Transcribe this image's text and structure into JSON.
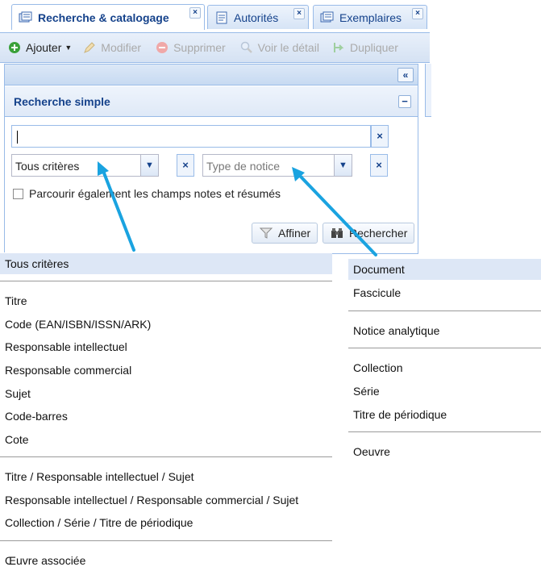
{
  "tabs": [
    {
      "label": "Recherche & catalogage",
      "close": "×"
    },
    {
      "label": "Autorités",
      "close": "×"
    },
    {
      "label": "Exemplaires",
      "close": "×"
    }
  ],
  "toolbar": {
    "add": "Ajouter",
    "edit": "Modifier",
    "delete": "Supprimer",
    "details": "Voir le détail",
    "duplicate": "Dupliquer"
  },
  "panel": {
    "collapse_glyph": "«",
    "title": "Recherche simple",
    "minus_glyph": "−",
    "search_value": "",
    "clear_glyph": "×",
    "criteria_value": "Tous critères",
    "notice_placeholder": "Type de notice",
    "checkbox_label": "Parcourir également les champs notes et résumés",
    "refine_label": "Affiner",
    "search_label": "Rechercher"
  },
  "criteria_list": {
    "selected": "Tous critères",
    "group1": [
      "Titre",
      "Code (EAN/ISBN/ISSN/ARK)",
      "Responsable intellectuel",
      "Responsable commercial",
      "Sujet",
      "Code-barres",
      "Cote"
    ],
    "group2": [
      "Titre / Responsable intellectuel / Sujet",
      "Responsable intellectuel / Responsable commercial / Sujet",
      "Collection / Série / Titre de périodique"
    ],
    "group3": [
      "Œuvre associée"
    ]
  },
  "notice_list": {
    "group1": [
      "Document",
      "Fascicule"
    ],
    "group2": [
      "Notice analytique"
    ],
    "group3": [
      "Collection",
      "Série",
      "Titre de périodique"
    ],
    "group4": [
      "Oeuvre"
    ]
  },
  "colors": {
    "accent": "#15428b",
    "border": "#99bbe8",
    "arrow": "#1aa3e0"
  }
}
